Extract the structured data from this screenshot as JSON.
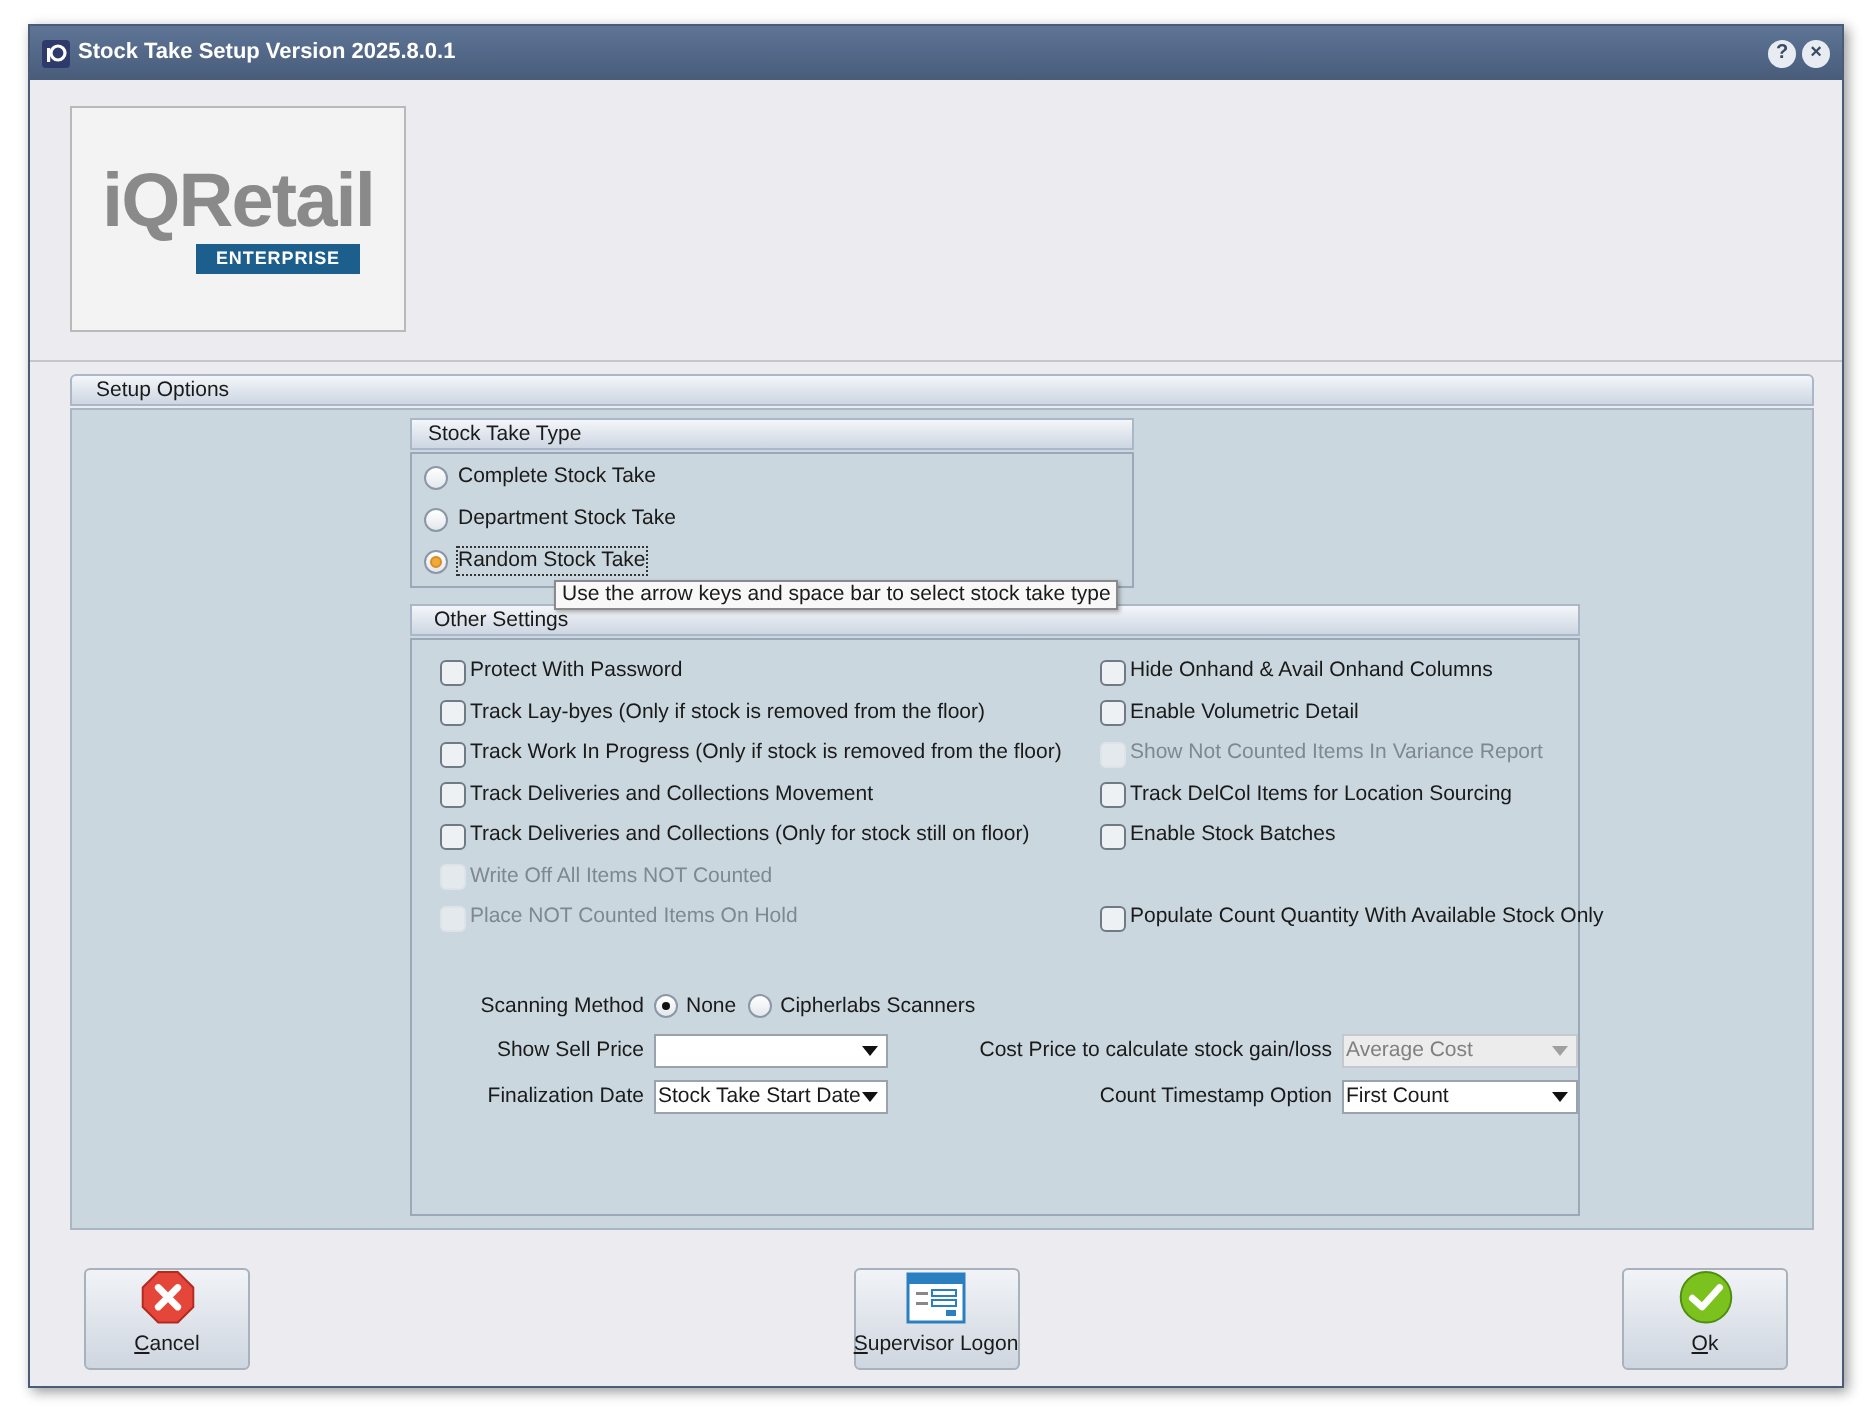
{
  "window": {
    "title": "Stock Take Setup Version 2025.8.0.1",
    "controls": [
      "?",
      "×"
    ]
  },
  "logo": {
    "brand": "iQRetail",
    "edition": "ENTERPRISE"
  },
  "setup_options": {
    "title": "Setup Options"
  },
  "stock_take_type": {
    "title": "Stock Take Type",
    "options": [
      {
        "label": "Complete Stock Take",
        "selected": false
      },
      {
        "label": "Department Stock Take",
        "selected": false
      },
      {
        "label": "Random Stock Take",
        "selected": true
      }
    ]
  },
  "tooltip": "Use  the arrow keys and space bar to select stock take type",
  "other_settings": {
    "title": "Other Settings",
    "rows": [
      {
        "left": {
          "label": "Protect With Password",
          "checked": false,
          "disabled": false
        },
        "right": {
          "label": "Hide Onhand & Avail Onhand Columns",
          "checked": false,
          "disabled": false
        }
      },
      {
        "left": {
          "label": "Track Lay-byes (Only if stock is removed from the floor)",
          "checked": false,
          "disabled": false
        },
        "right": {
          "label": "Enable Volumetric Detail",
          "checked": false,
          "disabled": false
        }
      },
      {
        "left": {
          "label": "Track Work In Progress (Only if stock is removed from the floor)",
          "checked": false,
          "disabled": false
        },
        "right": {
          "label": "Show Not Counted Items In Variance Report",
          "checked": false,
          "disabled": true
        }
      },
      {
        "left": {
          "label": "Track Deliveries and Collections Movement",
          "checked": false,
          "disabled": false
        },
        "right": {
          "label": "Track DelCol Items for Location Sourcing",
          "checked": false,
          "disabled": false
        }
      },
      {
        "left": {
          "label": "Track Deliveries and Collections (Only for stock still on floor)",
          "checked": false,
          "disabled": false
        },
        "right": {
          "label": "Enable Stock Batches",
          "checked": false,
          "disabled": false
        }
      },
      {
        "left": {
          "label": "Write Off All Items NOT Counted",
          "checked": false,
          "disabled": true
        }
      },
      {
        "left": {
          "label": "Place NOT Counted Items On Hold",
          "checked": false,
          "disabled": true
        },
        "right": {
          "label": "Populate Count Quantity With Available Stock Only",
          "checked": false,
          "disabled": false
        }
      }
    ],
    "scanning_method": {
      "label": "Scanning Method",
      "options": [
        {
          "label": "None",
          "selected": true
        },
        {
          "label": "Cipherlabs Scanners",
          "selected": false
        }
      ]
    },
    "show_sell_price": {
      "label": "Show Sell Price",
      "disabled": false
    },
    "finalization_date": {
      "label": "Finalization Date",
      "value": "Stock Take Start Date",
      "disabled": false
    },
    "cost_price": {
      "label": "Cost Price to calculate stock gain/loss",
      "value": "Average Cost",
      "disabled": true
    },
    "count_timestamp": {
      "label": "Count Timestamp Option",
      "value": "First Count",
      "disabled": false
    }
  },
  "buttons": [
    {
      "kind": "cancel",
      "label": "Cancel"
    },
    {
      "kind": "supervisor",
      "label": "Supervisor Logon"
    },
    {
      "kind": "ok",
      "label": "Ok"
    }
  ]
}
